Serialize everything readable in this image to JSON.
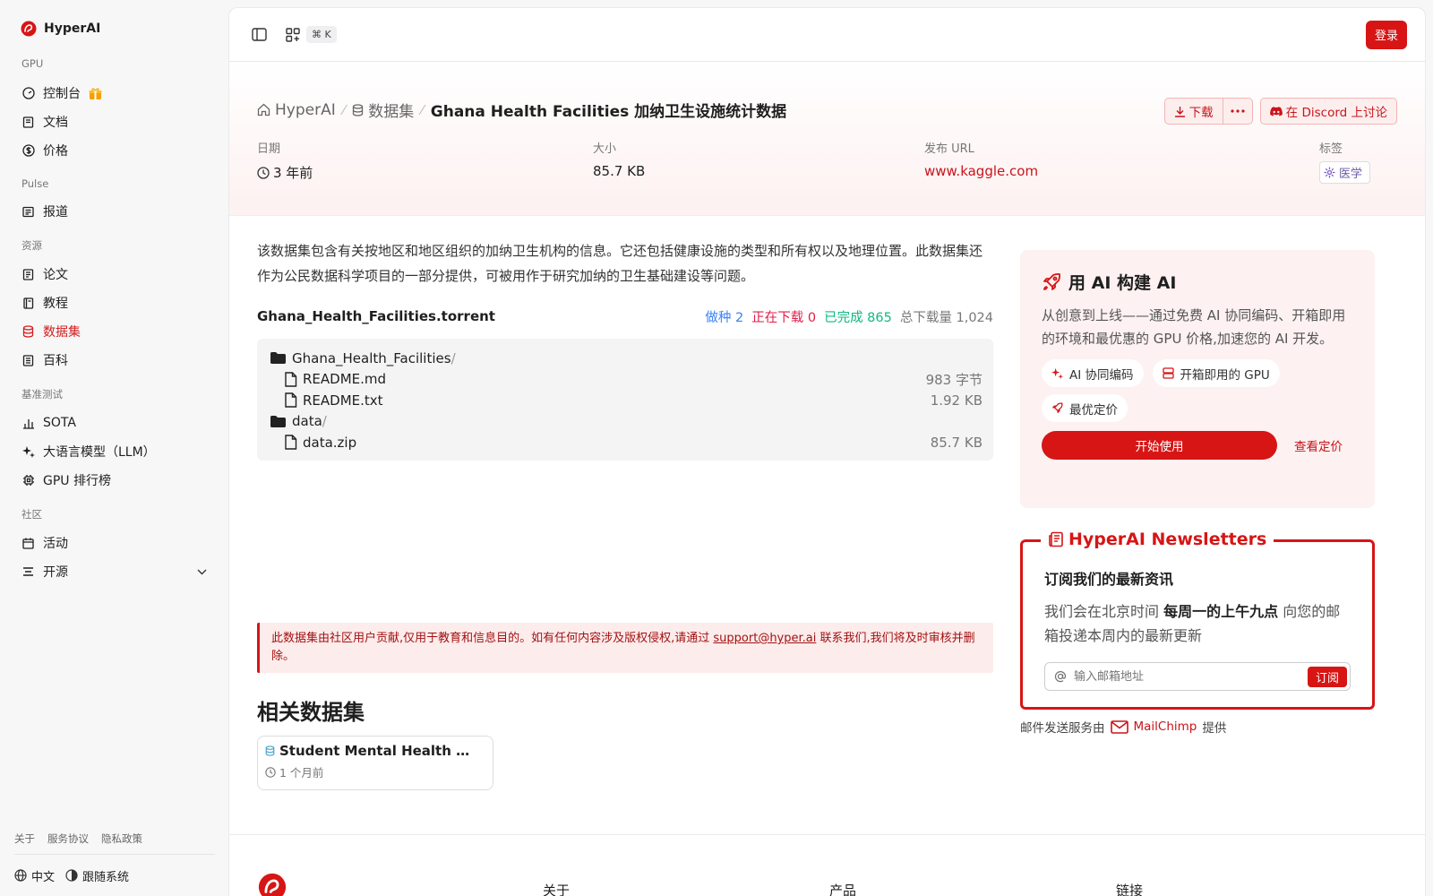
{
  "sidebar": {
    "brand": "HyperAI",
    "sections": [
      {
        "title": "GPU",
        "items": [
          {
            "label": "控制台",
            "icon": "gauge-icon"
          },
          {
            "label": "文档",
            "icon": "book-icon"
          },
          {
            "label": "价格",
            "icon": "dollar-icon"
          }
        ]
      },
      {
        "title": "Pulse",
        "items": [
          {
            "label": "报道",
            "icon": "newspaper-icon"
          }
        ]
      },
      {
        "title": "资源",
        "items": [
          {
            "label": "论文",
            "icon": "paper-icon"
          },
          {
            "label": "教程",
            "icon": "notebook-icon"
          },
          {
            "label": "数据集",
            "icon": "database-icon"
          },
          {
            "label": "百科",
            "icon": "encyclopedia-icon"
          }
        ]
      },
      {
        "title": "基准测试",
        "items": [
          {
            "label": "SOTA",
            "icon": "bar-chart-icon"
          },
          {
            "label": "大语言模型（LLM）",
            "icon": "sparkle-icon"
          },
          {
            "label": "GPU 排行榜",
            "icon": "chip-icon"
          }
        ]
      },
      {
        "title": "社区",
        "items": [
          {
            "label": "活动",
            "icon": "calendar-icon"
          },
          {
            "label": "开源",
            "icon": "list-icon"
          }
        ]
      }
    ],
    "footer_links": [
      "关于",
      "服务协议",
      "隐私政策"
    ],
    "language": "中文",
    "theme": "跟随系统"
  },
  "topbar": {
    "shortcut": "⌘ K",
    "login": "登录"
  },
  "header": {
    "breadcrumb_home": "HyperAI",
    "breadcrumb_section": "数据集",
    "title": "Ghana Health Facilities 加纳卫生设施统计数据",
    "download": "下载",
    "discord": "在 Discord 上讨论",
    "meta": {
      "date_label": "日期",
      "date_value": "3 年前",
      "size_label": "大小",
      "size_value": "85.7 KB",
      "url_label": "发布 URL",
      "url_value": "www.kaggle.com",
      "tags_label": "标签",
      "tag": "医学"
    }
  },
  "content": {
    "description": "该数据集包含有关按地区和地区组织的加纳卫生机构的信息。它还包括健康设施的类型和所有权以及地理位置。此数据集还作为公民数据科学项目的一部分提供，可被用作于研究加纳的卫生基础建设等问题。",
    "torrent_name": "Ghana_Health_Facilities.torrent",
    "stats": {
      "seeding": "做种 2",
      "downloading": "正在下载 0",
      "completed": "已完成 865",
      "total": "总下载量 1,024"
    },
    "files": [
      {
        "name": "Ghana_Health_Facilities",
        "type": "folder",
        "size": ""
      },
      {
        "name": "README.md",
        "type": "file",
        "size": "983 字节"
      },
      {
        "name": "README.txt",
        "type": "file",
        "size": "1.92 KB"
      },
      {
        "name": "data",
        "type": "folder",
        "size": ""
      },
      {
        "name": "data.zip",
        "type": "file",
        "size": "85.7 KB"
      }
    ],
    "notice_before": "此数据集由社区用户贡献,仅用于教育和信息目的。如有任何内容涉及版权侵权,请通过 ",
    "notice_email": "support@hyper.ai",
    "notice_after": " 联系我们,我们将及时审核并删除。",
    "related_title": "相关数据集",
    "related": [
      {
        "title": "Student Mental Health …",
        "date": "1 个月前"
      }
    ]
  },
  "promo": {
    "title": "用 AI 构建 AI",
    "text": "从创意到上线——通过免费 AI 协同编码、开箱即用的环境和最优惠的 GPU 价格,加速您的 AI 开发。",
    "chips": [
      "AI 协同编码",
      "开箱即用的 GPU",
      "最优定价"
    ],
    "start": "开始使用",
    "pricing": "查看定价"
  },
  "newsletter": {
    "legend": "HyperAI Newsletters",
    "title": "订阅我们的最新资讯",
    "text_before": "我们会在北京时间 ",
    "text_bold": "每周一的上午九点",
    "text_after": " 向您的邮箱投递本周内的最新更新",
    "placeholder": "输入邮箱地址",
    "subscribe": "订阅",
    "provider_prefix": "邮件发送服务由",
    "provider": "MailChimp",
    "provider_suffix": "提供"
  },
  "footer": {
    "columns": [
      "关于",
      "产品",
      "链接"
    ]
  },
  "colors": {
    "accent": "#d71515",
    "seeding": "#3b82f6",
    "downloading": "#e11d48",
    "completed": "#10b981",
    "total": "#777777"
  }
}
